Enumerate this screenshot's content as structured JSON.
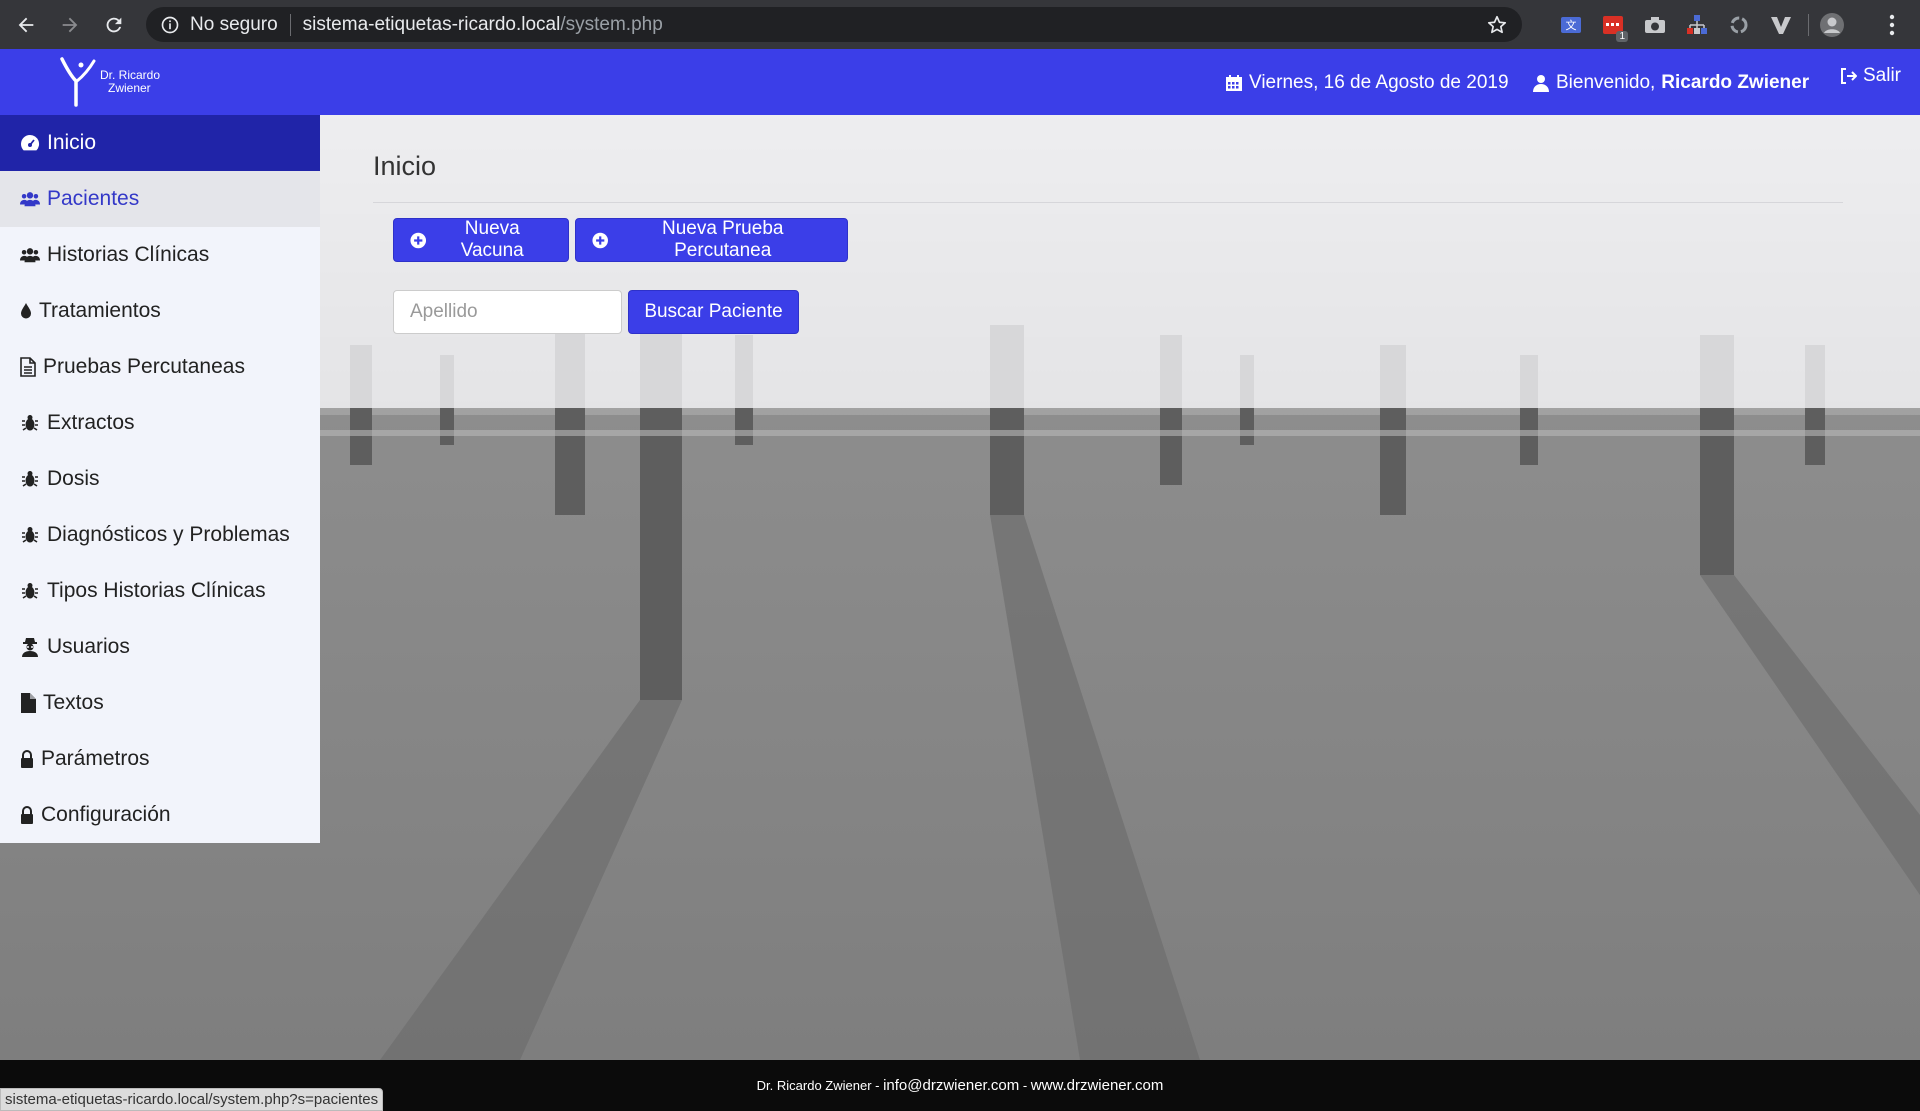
{
  "browser": {
    "security_label": "No seguro",
    "url_host": "sistema-etiquetas-ricardo.local",
    "url_path": "/system.php",
    "extensions": [
      "translate-extension-icon",
      "calendar-extension-icon",
      "camera-extension-icon",
      "network-extension-icon",
      "sync-extension-icon",
      "v-extension-icon",
      "profile-avatar-icon"
    ],
    "calendar_badge": "1"
  },
  "header": {
    "logo_line1": "Dr. Ricardo",
    "logo_line2": "Zwiener",
    "date": "Viernes, 16 de Agosto de 2019",
    "welcome": "Bienvenido,",
    "user_name": "Ricardo Zwiener",
    "exit": "Salir",
    "color": "#3b3ee8"
  },
  "sidebar": {
    "items": [
      {
        "label": "Inicio",
        "icon": "dashboard-icon",
        "state": "active"
      },
      {
        "label": "Pacientes",
        "icon": "users-icon",
        "state": "hover"
      },
      {
        "label": "Historias Clínicas",
        "icon": "users-icon",
        "state": ""
      },
      {
        "label": "Tratamientos",
        "icon": "drop-icon",
        "state": ""
      },
      {
        "label": "Pruebas Percutaneas",
        "icon": "document-icon",
        "state": ""
      },
      {
        "label": "Extractos",
        "icon": "bug-icon",
        "state": ""
      },
      {
        "label": "Dosis",
        "icon": "bug-icon",
        "state": ""
      },
      {
        "label": "Diagnósticos y Problemas",
        "icon": "bug-icon",
        "state": ""
      },
      {
        "label": "Tipos Historias Clínicas",
        "icon": "bug-icon",
        "state": ""
      },
      {
        "label": "Usuarios",
        "icon": "user-secret-icon",
        "state": ""
      },
      {
        "label": "Textos",
        "icon": "file-icon",
        "state": ""
      },
      {
        "label": "Parámetros",
        "icon": "lock-icon",
        "state": ""
      },
      {
        "label": "Configuración",
        "icon": "lock-icon",
        "state": ""
      }
    ]
  },
  "main": {
    "title": "Inicio",
    "new_vaccine_label": "Nueva Vacuna",
    "new_test_label": "Nueva Prueba Percutanea",
    "search_placeholder": "Apellido",
    "search_value": "",
    "search_button": "Buscar Paciente"
  },
  "footer": {
    "name": "Dr. Ricardo Zwiener",
    "dash1": " - ",
    "email": "info@drzwiener.com",
    "dash2": " - ",
    "website": "www.drzwiener.com"
  },
  "status_bar_url": "sistema-etiquetas-ricardo.local/system.php?s=pacientes"
}
